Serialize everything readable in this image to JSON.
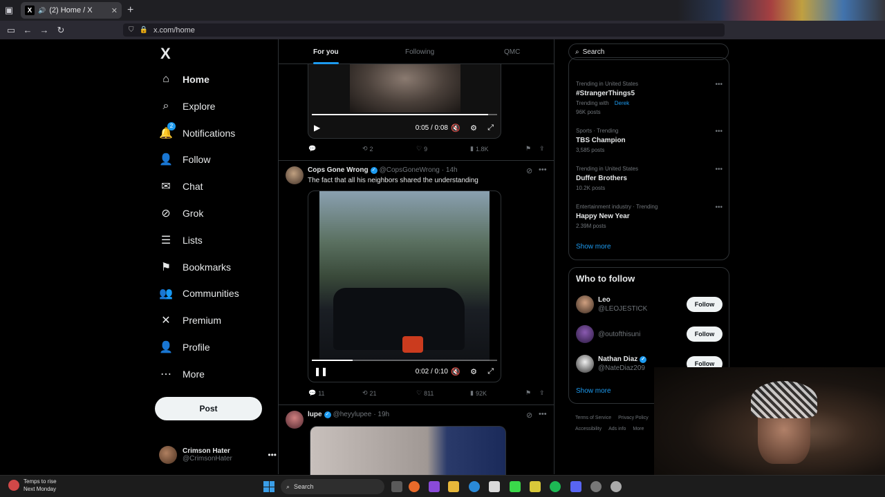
{
  "browser": {
    "tab_title": "(2) Home / X",
    "url": "x.com/home"
  },
  "nav": {
    "logo": "X",
    "items": [
      {
        "label": "Home",
        "icon": "home-icon",
        "glyph": "⌂",
        "active": true
      },
      {
        "label": "Explore",
        "icon": "search-icon",
        "glyph": "⌕"
      },
      {
        "label": "Notifications",
        "icon": "bell-icon",
        "glyph": "🔔",
        "badge": "2"
      },
      {
        "label": "Follow",
        "icon": "person-plus-icon",
        "glyph": "👤"
      },
      {
        "label": "Chat",
        "icon": "mail-icon",
        "glyph": "✉"
      },
      {
        "label": "Grok",
        "icon": "grok-icon",
        "glyph": "⊘"
      },
      {
        "label": "Lists",
        "icon": "list-icon",
        "glyph": "☰"
      },
      {
        "label": "Bookmarks",
        "icon": "bookmark-icon",
        "glyph": "⚑"
      },
      {
        "label": "Communities",
        "icon": "communities-icon",
        "glyph": "👥"
      },
      {
        "label": "Premium",
        "icon": "x-premium-icon",
        "glyph": "✕"
      },
      {
        "label": "Profile",
        "icon": "profile-icon",
        "glyph": "👤"
      },
      {
        "label": "More",
        "icon": "more-circle-icon",
        "glyph": "⋯"
      }
    ],
    "post_label": "Post",
    "account": {
      "name": "Crimson Hater",
      "handle": "@CrimsonHater"
    }
  },
  "feed": {
    "tabs": [
      "For you",
      "Following",
      "QMC"
    ],
    "tweet1": {
      "video_time": "0:05 / 0:08",
      "replies": "",
      "retweets": "2",
      "likes": "9",
      "views": "1.8K"
    },
    "tweet2": {
      "name": "Cops Gone Wrong",
      "handle": "@CopsGoneWrong",
      "age": "· 14h",
      "text": "The fact that all his neighbors shared the understanding",
      "video_time": "0:02 / 0:10",
      "replies": "11",
      "retweets": "21",
      "likes": "811",
      "views": "92K"
    },
    "tweet3": {
      "name": "lupe",
      "handle": "@heyylupee",
      "age": "· 19h"
    }
  },
  "sidebar": {
    "search_placeholder": "Search",
    "trends": [
      {
        "context": "Trending in United States",
        "title": "#StrangerThings5",
        "sub": "Trending with",
        "sub_link": "Derek",
        "posts": "96K posts"
      },
      {
        "context": "Sports · Trending",
        "title": "TBS Champion",
        "posts": "3,585 posts"
      },
      {
        "context": "Trending in United States",
        "title": "Duffer Brothers",
        "posts": "10.2K posts"
      },
      {
        "context": "Entertainment industry · Trending",
        "title": "Happy New Year",
        "posts": "2.39M posts"
      }
    ],
    "show_more": "Show more",
    "who_to_follow": {
      "title": "Who to follow",
      "users": [
        {
          "name": "Leo",
          "handle": "@LEOJESTICK",
          "verified": false
        },
        {
          "name": "",
          "handle": "@outofthisuni",
          "verified": false
        },
        {
          "name": "Nathan Diaz",
          "handle": "@NateDiaz209",
          "verified": true
        }
      ],
      "follow_label": "Follow",
      "show_more": "Show more"
    },
    "footer": [
      "Terms of Service",
      "Privacy Policy",
      "Accessibility",
      "Ads info",
      "More"
    ]
  },
  "taskbar": {
    "weather_line1": "Temps to rise",
    "weather_line2": "Next Monday",
    "search": "Search"
  }
}
